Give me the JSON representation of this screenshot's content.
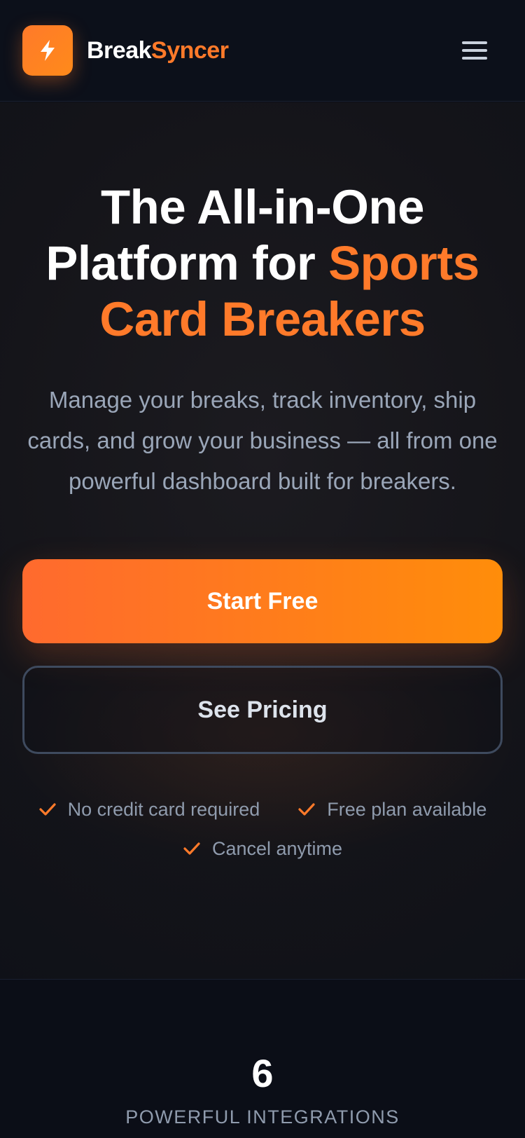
{
  "header": {
    "brand_part1": "Break",
    "brand_part2": "Syncer",
    "logo_icon": "lightning-bolt-icon",
    "menu_icon": "hamburger-menu-icon"
  },
  "hero": {
    "headline_part1": "The All-in-One Platform for ",
    "headline_accent": "Sports Card Breakers",
    "subtext": "Manage your breaks, track inventory, ship cards, and grow your business — all from one powerful dashboard built for breakers.",
    "primary_cta": "Start Free",
    "secondary_cta": "See Pricing",
    "perks": [
      {
        "label": "No credit card required",
        "icon": "check-icon"
      },
      {
        "label": "Free plan available",
        "icon": "check-icon"
      },
      {
        "label": "Cancel anytime",
        "icon": "check-icon"
      }
    ]
  },
  "stats": {
    "number": "6",
    "label": "POWERFUL INTEGRATIONS"
  },
  "colors": {
    "accent": "#ff7a2a",
    "background": "#0b0e17",
    "text_muted": "#8f9bad"
  }
}
